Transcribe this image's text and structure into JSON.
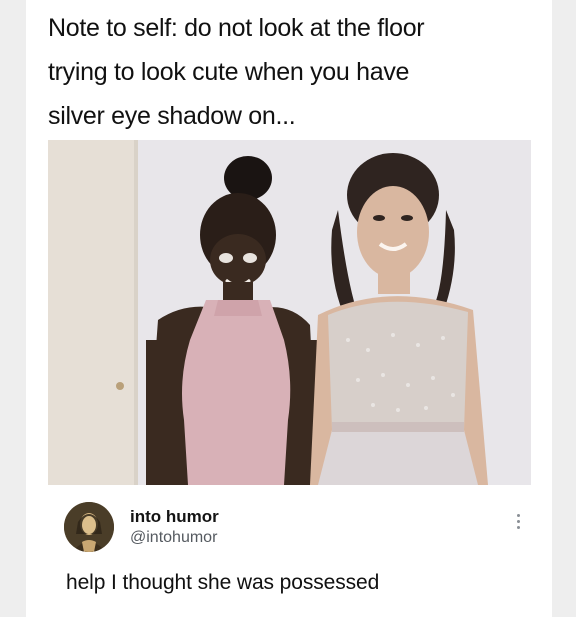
{
  "post": {
    "caption_lines": [
      "Note to self: do not look at the floor",
      "trying to look cute when you have",
      "silver eye shadow on..."
    ],
    "photo_icon": "photo-of-two-women-in-dresses"
  },
  "tweet": {
    "display_name": "into humor",
    "handle": "@intohumor",
    "text": "help I thought she was possessed",
    "avatar_icon": "portrait-avatar",
    "menu_icon": "more-options-icon"
  },
  "colors": {
    "background": "#eeeeee",
    "card": "#ffffff",
    "text": "#111111",
    "handle": "#555a60"
  }
}
